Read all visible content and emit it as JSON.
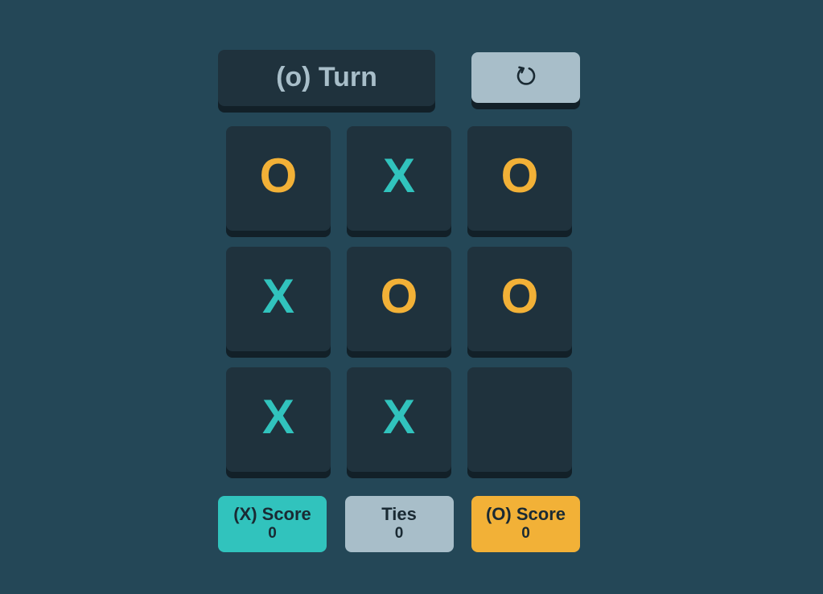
{
  "turn": {
    "label": "(o) Turn"
  },
  "restart": {
    "icon": "restart-icon"
  },
  "board": {
    "cells": [
      "O",
      "X",
      "O",
      "X",
      "O",
      "O",
      "X",
      "X",
      ""
    ]
  },
  "scores": {
    "x": {
      "label": "(X) Score",
      "value": "0"
    },
    "ties": {
      "label": "Ties",
      "value": "0"
    },
    "o": {
      "label": "(O) Score",
      "value": "0"
    }
  },
  "colors": {
    "background": "#244757",
    "tile": "#1f323d",
    "x_mark": "#31c3bd",
    "o_mark": "#f2b137",
    "neutral": "#a8bec9"
  }
}
